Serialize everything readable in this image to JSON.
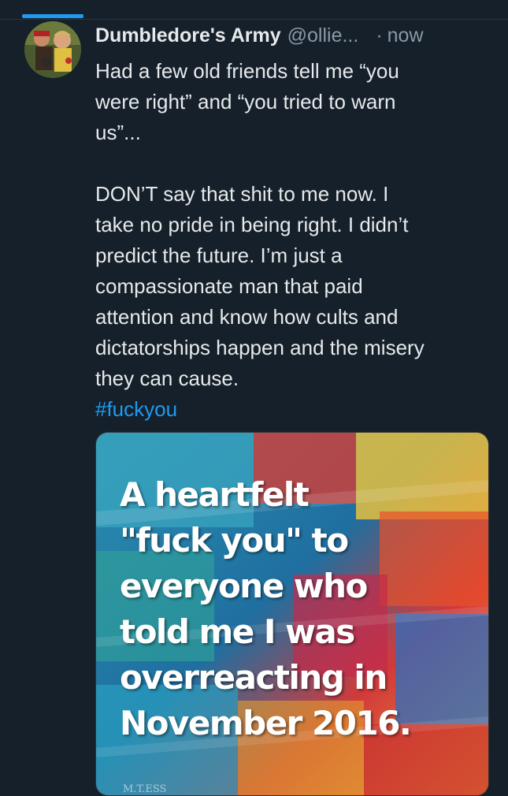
{
  "tweet": {
    "display_name": "Dumbledore's Army",
    "handle": "@ollie...",
    "separator": "·",
    "timestamp": "now",
    "body_lines_1": [
      "Had a few old friends tell me “you",
      "were right” and “you tried to warn",
      "us”..."
    ],
    "body_lines_2": [
      "DON’T say that shit to me now. I",
      "take no pride in being right. I didn’t",
      "predict the future. I’m just a",
      "compassionate man that paid",
      "attention and know how cults and",
      "dictatorships happen and the misery",
      "they can cause."
    ],
    "hashtag": "#fuckyou"
  },
  "media": {
    "image_text_lines": [
      "A heartfelt",
      "\"fuck you\" to",
      "everyone who",
      "told me I was",
      "overreacting in",
      "November 2016."
    ],
    "watermark": "M.T.ESS"
  },
  "colors": {
    "background": "#15202b",
    "accent": "#1d9bf0",
    "secondary_text": "#8b98a5"
  }
}
